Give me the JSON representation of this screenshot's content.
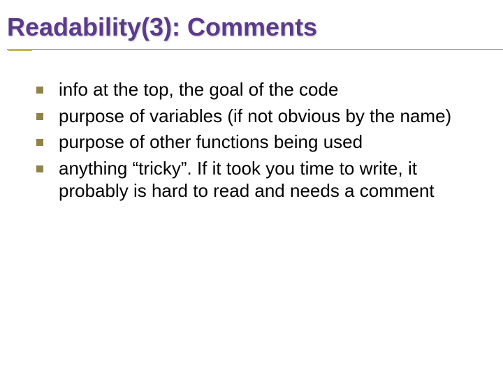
{
  "title": "Readability(3): Comments",
  "bullets": [
    "info at the top, the goal of the code",
    "purpose of variables (if not obvious by the name)",
    "purpose of other functions being used",
    "anything “tricky”. If it took you time to write, it probably is hard to read and needs a comment"
  ]
}
